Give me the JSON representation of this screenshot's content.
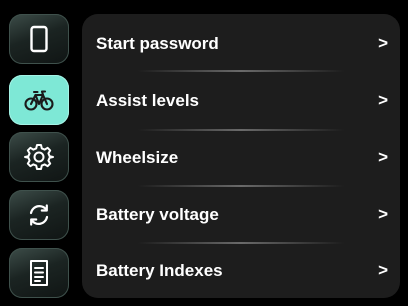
{
  "sidebar": {
    "items": [
      {
        "icon": "phone-icon",
        "active": false
      },
      {
        "icon": "bicycle-icon",
        "active": true
      },
      {
        "icon": "gear-icon",
        "active": false
      },
      {
        "icon": "refresh-icon",
        "active": false
      },
      {
        "icon": "document-icon",
        "active": false
      }
    ]
  },
  "menu": {
    "chevron": ">",
    "items": [
      {
        "label": "Start password"
      },
      {
        "label": "Assist levels"
      },
      {
        "label": "Wheelsize"
      },
      {
        "label": "Battery voltage"
      },
      {
        "label": "Battery Indexes"
      }
    ]
  },
  "colors": {
    "accent": "#7ee8d6",
    "panel": "#1d1d1d",
    "background": "#000000",
    "text": "#ffffff"
  }
}
